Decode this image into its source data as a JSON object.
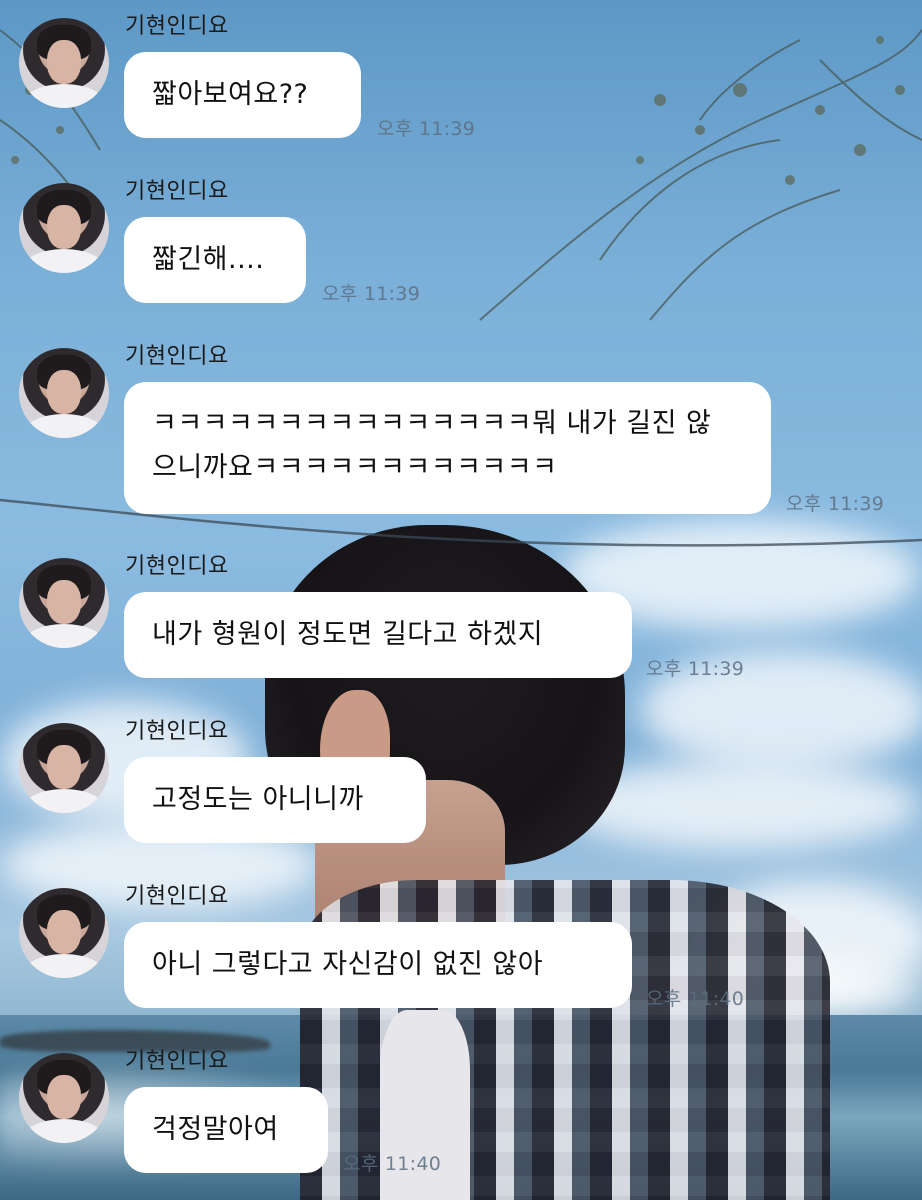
{
  "chat": {
    "sender_name": "기현인디요",
    "messages": [
      {
        "text": "짧아보여요??",
        "time": "오후 11:39"
      },
      {
        "text": "짧긴해....",
        "time": "오후 11:39"
      },
      {
        "text_line1": "ㅋㅋㅋㅋㅋㅋㅋㅋㅋㅋㅋㅋㅋㅋㅋ뭐 내가 길진 않",
        "text_line2": "으니까요ㅋㅋㅋㅋㅋㅋㅋㅋㅋㅋㅋㅋ",
        "time": "오후 11:39"
      },
      {
        "text": "내가 형원이 정도면 길다고 하겠지",
        "time": "오후 11:39"
      },
      {
        "text": "고정도는 아니니까",
        "time": ""
      },
      {
        "text": "아니 그렇다고 자신감이 없진 않아",
        "time": "오후 11:40"
      },
      {
        "text": "걱정말아여",
        "time": "오후 11:40"
      }
    ]
  },
  "colors": {
    "bubble": "#ffffff",
    "time_text": "#5a6e82",
    "sender_text": "#1b1b1b"
  },
  "icons": {
    "avatar": "profile-photo"
  }
}
